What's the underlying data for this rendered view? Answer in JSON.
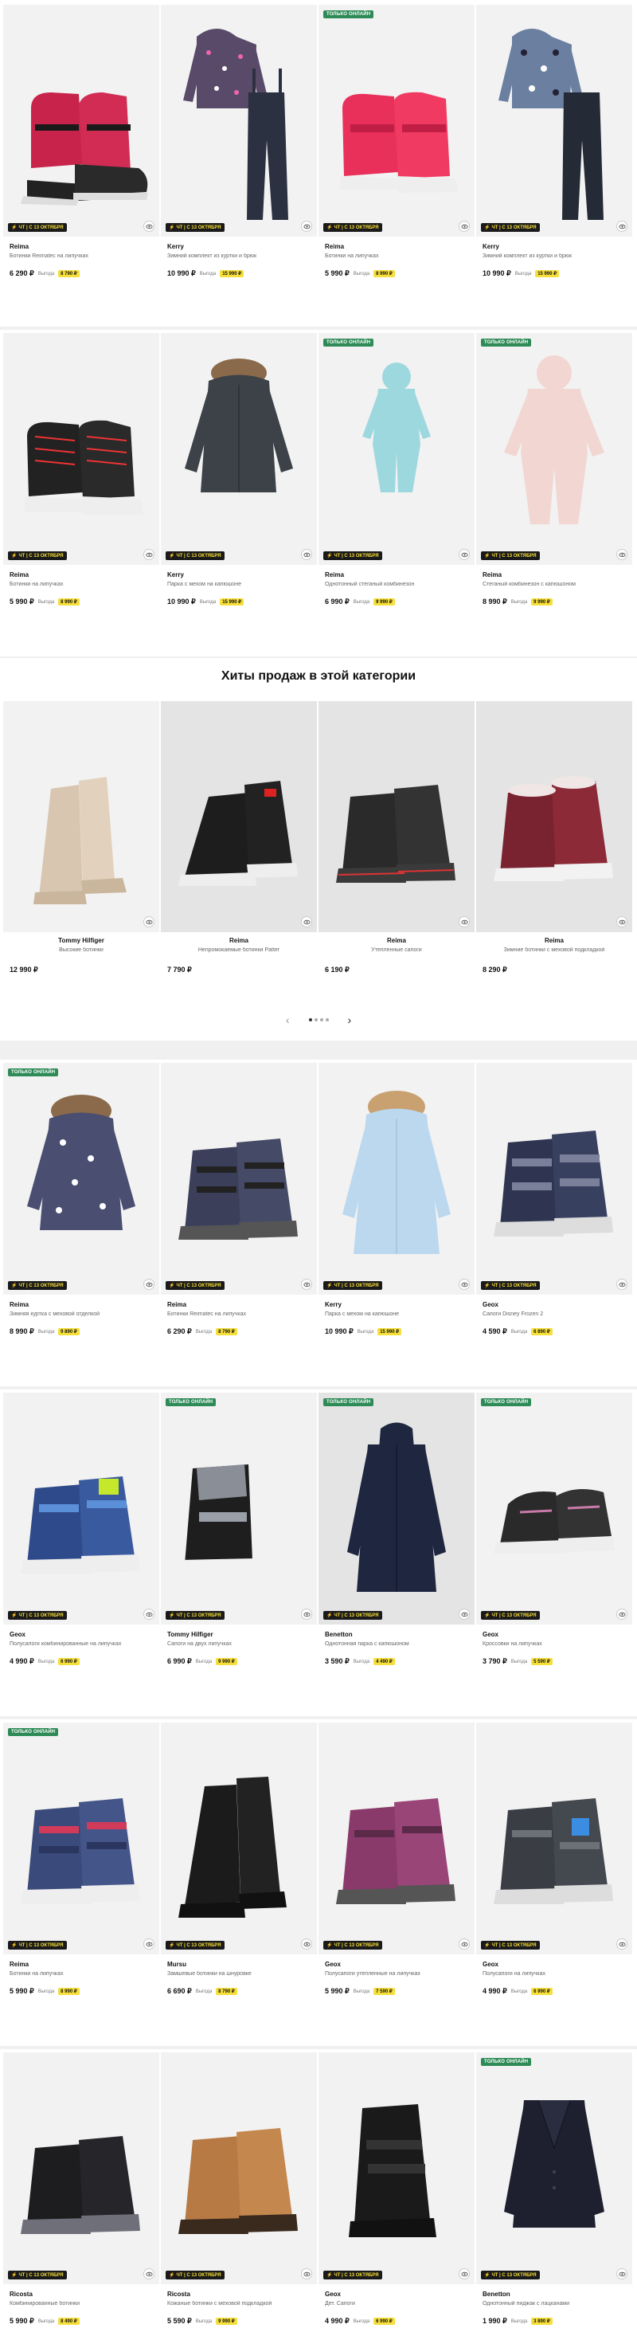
{
  "labels": {
    "online_only": "ТОЛЬКО ОНЛАЙН",
    "promo": "ЧТ | С 13 ОКТЯБРЯ",
    "save": "Выгода",
    "hits_title": "Хиты продаж в этой категории"
  },
  "row1": [
    {
      "brand": "Reima",
      "name": "Ботинки Reimatec на липучках",
      "price": "6 290 ₽",
      "old": "8 790 ₽",
      "online": false
    },
    {
      "brand": "Kerry",
      "name": "Зимний комплект из куртки и брюк",
      "price": "10 990 ₽",
      "old": "15 990 ₽",
      "online": false
    },
    {
      "brand": "Reima",
      "name": "Ботинки на липучках",
      "price": "5 990 ₽",
      "old": "8 990 ₽",
      "online": true
    },
    {
      "brand": "Kerry",
      "name": "Зимний комплект из куртки и брюк",
      "price": "10 990 ₽",
      "old": "15 990 ₽",
      "online": false
    }
  ],
  "row2": [
    {
      "brand": "Reima",
      "name": "Ботинки на липучках",
      "price": "5 990 ₽",
      "old": "8 990 ₽",
      "online": false
    },
    {
      "brand": "Kerry",
      "name": "Парка с мехом на капюшоне",
      "price": "10 990 ₽",
      "old": "15 990 ₽",
      "online": false
    },
    {
      "brand": "Reima",
      "name": "Однотонный стеганый комбинезон",
      "price": "6 990 ₽",
      "old": "9 990 ₽",
      "online": true
    },
    {
      "brand": "Reima",
      "name": "Стеганый комбинезон с капюшоном",
      "price": "8 990 ₽",
      "old": "9 990 ₽",
      "online": true
    }
  ],
  "hits": [
    {
      "brand": "Tommy Hilfiger",
      "name": "Высокие ботинки",
      "price": "12 990 ₽"
    },
    {
      "brand": "Reima",
      "name": "Непромокаемые ботинки Patter",
      "price": "7 790 ₽"
    },
    {
      "brand": "Reima",
      "name": "Утепленные сапоги",
      "price": "6 190 ₽"
    },
    {
      "brand": "Reima",
      "name": "Зимние ботинки с меховой подкладкой",
      "price": "8 290 ₽"
    }
  ],
  "row3": [
    {
      "brand": "Reima",
      "name": "Зимняя куртка с меховой отделкой",
      "price": "8 990 ₽",
      "old": "9 890 ₽",
      "online": true
    },
    {
      "brand": "Reima",
      "name": "Ботинки Reimatec на липучках",
      "price": "6 290 ₽",
      "old": "8 790 ₽",
      "online": false
    },
    {
      "brand": "Kerry",
      "name": "Парка с мехом на капюшоне",
      "price": "10 990 ₽",
      "old": "15 990 ₽",
      "online": false
    },
    {
      "brand": "Geox",
      "name": "Сапоги Disney Frozen 2",
      "price": "4 590 ₽",
      "old": "6 890 ₽",
      "online": false
    }
  ],
  "row4": [
    {
      "brand": "Geox",
      "name": "Полусапоги комбинированные на липучках",
      "price": "4 990 ₽",
      "old": "6 990 ₽",
      "online": false
    },
    {
      "brand": "Tommy Hilfiger",
      "name": "Сапоги на двух липучках",
      "price": "6 990 ₽",
      "old": "9 990 ₽",
      "online": true
    },
    {
      "brand": "Benetton",
      "name": "Однотонная парка с капюшоном",
      "price": "3 590 ₽",
      "old": "4 490 ₽",
      "online": true
    },
    {
      "brand": "Geox",
      "name": "Кроссовки на липучках",
      "price": "3 790 ₽",
      "old": "5 590 ₽",
      "online": true
    }
  ],
  "row5": [
    {
      "brand": "Reima",
      "name": "Ботинки на липучках",
      "price": "5 990 ₽",
      "old": "8 990 ₽",
      "online": true
    },
    {
      "brand": "Mursu",
      "name": "Замшевые ботинки на шнуровке",
      "price": "6 690 ₽",
      "old": "8 790 ₽",
      "online": false
    },
    {
      "brand": "Geox",
      "name": "Полусапоги утепленные на липучках",
      "price": "5 990 ₽",
      "old": "7 590 ₽",
      "online": false
    },
    {
      "brand": "Geox",
      "name": "Полусапоги на липучках",
      "price": "4 990 ₽",
      "old": "6 990 ₽",
      "online": false
    }
  ],
  "row6": [
    {
      "brand": "Ricosta",
      "name": "Комбинированные ботинки",
      "price": "5 990 ₽",
      "old": "8 490 ₽",
      "online": false
    },
    {
      "brand": "Ricosta",
      "name": "Кожаные ботинки с меховой подкладкой",
      "price": "5 590 ₽",
      "old": "9 990 ₽",
      "online": false
    },
    {
      "brand": "Geox",
      "name": "Дет. Сапоги",
      "price": "4 990 ₽",
      "old": "6 990 ₽",
      "online": false
    },
    {
      "brand": "Benetton",
      "name": "Однотонный пиджак с лацканами",
      "price": "1 990 ₽",
      "old": "3 890 ₽",
      "online": true
    }
  ]
}
